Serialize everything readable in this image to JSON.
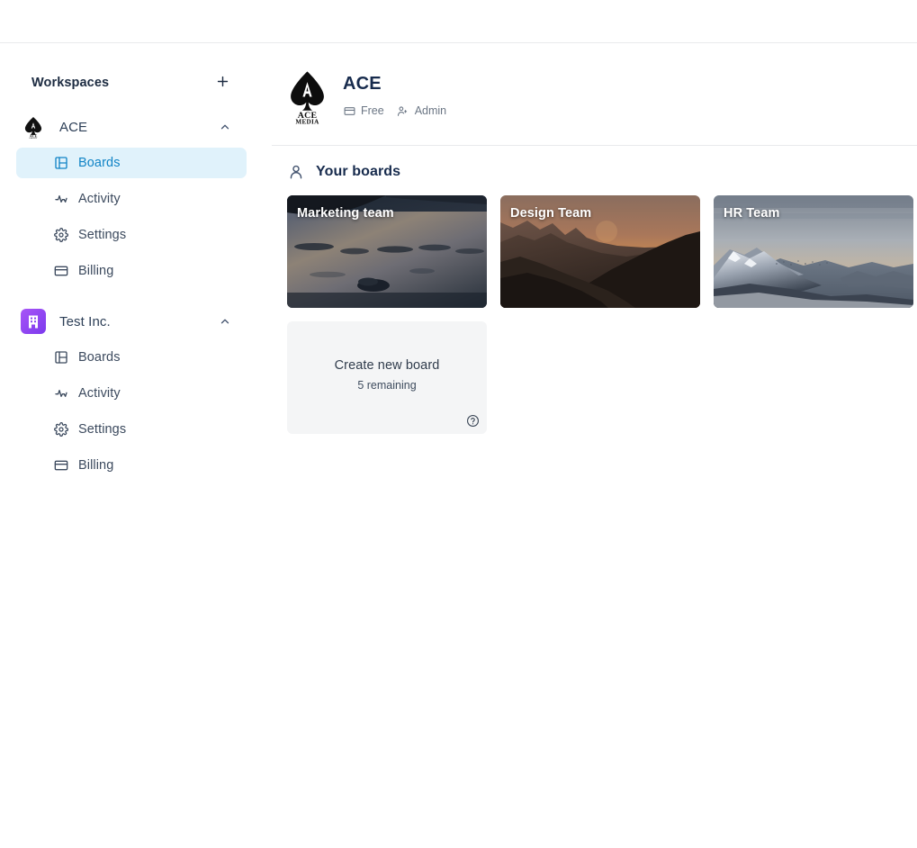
{
  "topbar": {
    "title": ""
  },
  "sidebar": {
    "header": {
      "label": "Workspaces",
      "add_icon": "plus-icon"
    },
    "workspaces": [
      {
        "name": "ACE",
        "logo_icon": "ace-spade-logo",
        "chevron_icon": "chevron-up-icon",
        "expanded": true,
        "items": [
          {
            "label": "Boards",
            "icon": "board-icon",
            "active": true
          },
          {
            "label": "Activity",
            "icon": "activity-pulse-icon",
            "active": false
          },
          {
            "label": "Settings",
            "icon": "gear-icon",
            "active": false
          },
          {
            "label": "Billing",
            "icon": "credit-card-icon",
            "active": false
          }
        ]
      },
      {
        "name": "Test Inc.",
        "logo_icon": "building-icon",
        "logo_color": "#9b4dff",
        "chevron_icon": "chevron-up-icon",
        "expanded": true,
        "items": [
          {
            "label": "Boards",
            "icon": "board-icon",
            "active": false
          },
          {
            "label": "Activity",
            "icon": "activity-pulse-icon",
            "active": false
          },
          {
            "label": "Settings",
            "icon": "gear-icon",
            "active": false
          },
          {
            "label": "Billing",
            "icon": "credit-card-icon",
            "active": false
          }
        ]
      }
    ]
  },
  "org": {
    "name": "ACE",
    "logo_icon": "ace-spade-logo",
    "logo_text_top": "ACE",
    "logo_text_bottom": "MEDIA",
    "plan_badge": {
      "label": "Free",
      "icon": "credit-card-icon"
    },
    "role_badge": {
      "label": "Admin",
      "icon": "person-check-icon"
    }
  },
  "boards_section": {
    "title": "Your boards",
    "icon": "person-icon",
    "boards": [
      {
        "title": "Marketing team",
        "image": "dark-coastal-water-dusk"
      },
      {
        "title": "Design Team",
        "image": "mountain-sunset-silhouette"
      },
      {
        "title": "HR Team",
        "image": "snowy-mountain-range"
      }
    ],
    "create": {
      "label": "Create new board",
      "remaining": "5 remaining",
      "help_icon": "help-circle-icon"
    }
  },
  "colors": {
    "accent": "#1184c6",
    "active_bg": "#e0f2fb",
    "text": "#172b4d",
    "muted": "#6b7684",
    "border": "#e9eaec",
    "create_bg": "#f4f5f6",
    "purple": "#9b4dff"
  }
}
